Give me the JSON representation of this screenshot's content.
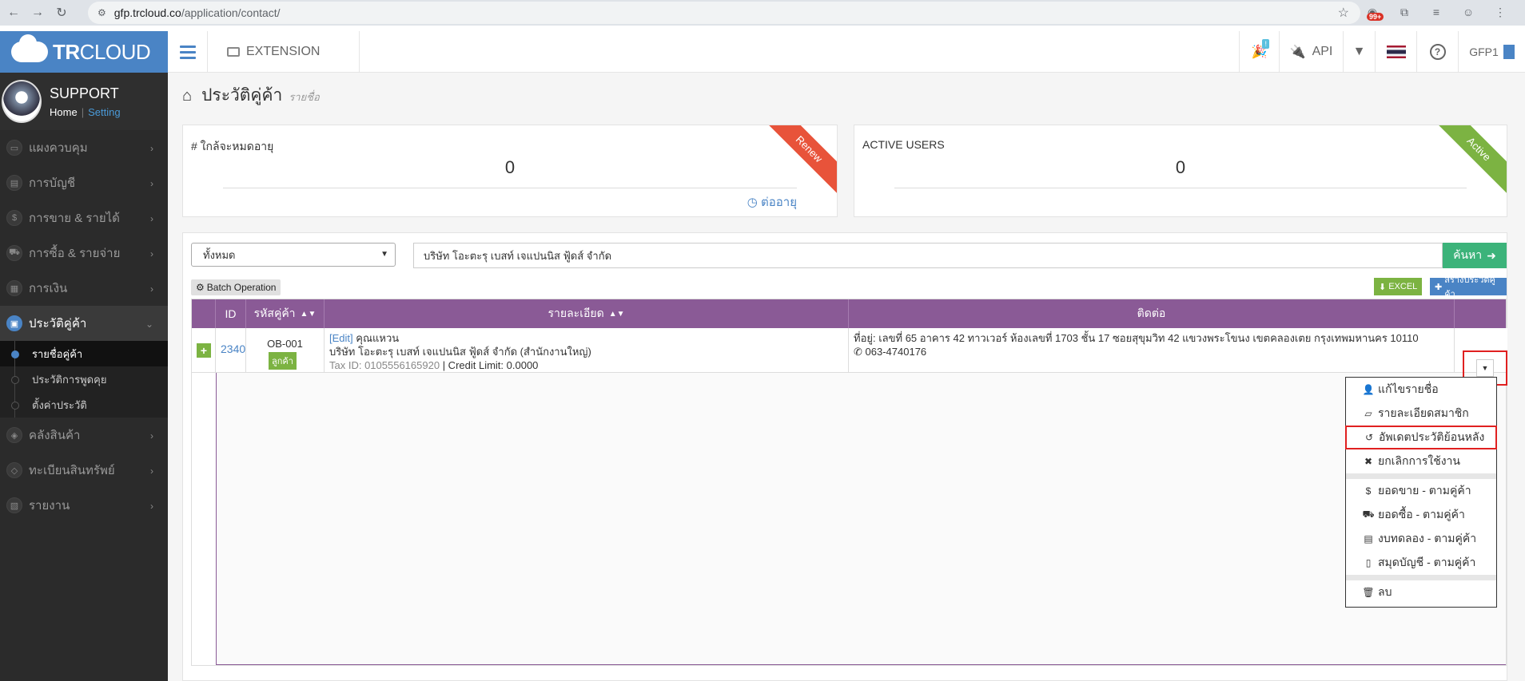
{
  "browser": {
    "url_host": "gfp.trcloud.co",
    "url_path": "/application/contact/",
    "badge": "99+"
  },
  "logo": {
    "bold": "TR",
    "rest": "CLOUD"
  },
  "profile": {
    "name": "SUPPORT",
    "home": "Home",
    "setting": "Setting"
  },
  "sidebar": {
    "items": [
      {
        "label": "แผงควบคุม",
        "icon": "monitor-icon",
        "glyph": "▭"
      },
      {
        "label": "การบัญชี",
        "icon": "book-icon",
        "glyph": "▤"
      },
      {
        "label": "การขาย & รายได้",
        "icon": "dollar-icon",
        "glyph": "$"
      },
      {
        "label": "การซื้อ & รายจ่าย",
        "icon": "cart-icon",
        "glyph": "⛟"
      },
      {
        "label": "การเงิน",
        "icon": "calendar-icon",
        "glyph": "▦"
      }
    ],
    "active": {
      "label": "ประวัติคู่ค้า",
      "icon": "contact-icon",
      "glyph": "▣"
    },
    "submenu": [
      "รายชื่อคู่ค้า",
      "ประวัติการพูดคุย",
      "ตั้งค่าประวัติ"
    ],
    "items_after": [
      {
        "label": "คลังสินค้า",
        "icon": "cubes-icon",
        "glyph": "◈"
      },
      {
        "label": "ทะเบียนสินทรัพย์",
        "icon": "diamond-icon",
        "glyph": "◇"
      },
      {
        "label": "รายงาน",
        "icon": "report-icon",
        "glyph": "▧"
      }
    ]
  },
  "topbar": {
    "extension": "EXTENSION",
    "notif_badge": "!",
    "api": "API",
    "company": "GFP1"
  },
  "page": {
    "title": "ประวัติคู่ค้า",
    "subtitle": "รายชื่อ"
  },
  "cards": {
    "expiring": {
      "label": "# ใกล้จะหมดอายุ",
      "value": "0",
      "link": "ต่ออายุ",
      "ribbon": "Renew",
      "ribbon_color": "#e8533a"
    },
    "active_users": {
      "label": "ACTIVE USERS",
      "value": "0",
      "ribbon": "Active",
      "ribbon_color": "#7cb342"
    }
  },
  "filters": {
    "select_value": "ทั้งหมด",
    "search_value": "บริษัท โอะตะรุ เบสท์ เจแปนนิส ฟู้ดส์ จำกัด",
    "search_button": "ค้นหา"
  },
  "actions": {
    "batch": "Batch Operation",
    "excel": "EXCEL",
    "create": "สร้างประวัติคู่ค้า"
  },
  "table": {
    "headers": {
      "id": "ID",
      "code": "รหัสคู่ค้า",
      "detail": "รายละเอียด",
      "contact": "ติดต่อ"
    },
    "row": {
      "id": "2340",
      "code": "OB-001",
      "type_badge": "ลูกค้า",
      "edit": "[Edit]",
      "contact_name": "คุณแหวน",
      "company": "บริษัท โอะตะรุ เบสท์ เจแปนนิส ฟู้ดส์ จำกัด (สำนักงานใหญ่)",
      "tax": "Tax ID: 0105556165920",
      "credit": "| Credit Limit: 0.0000",
      "address": "ที่อยู่: เลขที่ 65 อาคาร 42 ทาวเวอร์ ห้องเลขที่ 1703 ชั้น 17 ซอยสุขุมวิท 42 แขวงพระโขนง เขตคลองเตย กรุงเทพมหานคร 10110",
      "phone": "063-4740176"
    }
  },
  "dropdown": {
    "group1": [
      {
        "label": "แก้ไขรายชื่อ",
        "icon": "user-icon",
        "glyph": "👤"
      },
      {
        "label": "รายละเอียดสมาชิก",
        "icon": "map-icon",
        "glyph": "▱"
      },
      {
        "label": "อัพเดตประวัติย้อนหลัง",
        "icon": "history-icon",
        "glyph": "↺"
      },
      {
        "label": "ยกเลิกการใช้งาน",
        "icon": "times-icon",
        "glyph": "✖"
      }
    ],
    "group2": [
      {
        "label": "ยอดขาย - ตามคู่ค้า",
        "icon": "dollar-icon",
        "glyph": "$"
      },
      {
        "label": "ยอดซื้อ - ตามคู่ค้า",
        "icon": "cart-icon",
        "glyph": "⛟"
      },
      {
        "label": "งบทดลอง - ตามคู่ค้า",
        "icon": "book-icon",
        "glyph": "▤"
      },
      {
        "label": "สมุดบัญชี - ตามคู่ค้า",
        "icon": "file-icon",
        "glyph": "▯"
      }
    ],
    "group3": [
      {
        "label": "ลบ",
        "icon": "trash-icon",
        "glyph": "🗑"
      }
    ]
  }
}
